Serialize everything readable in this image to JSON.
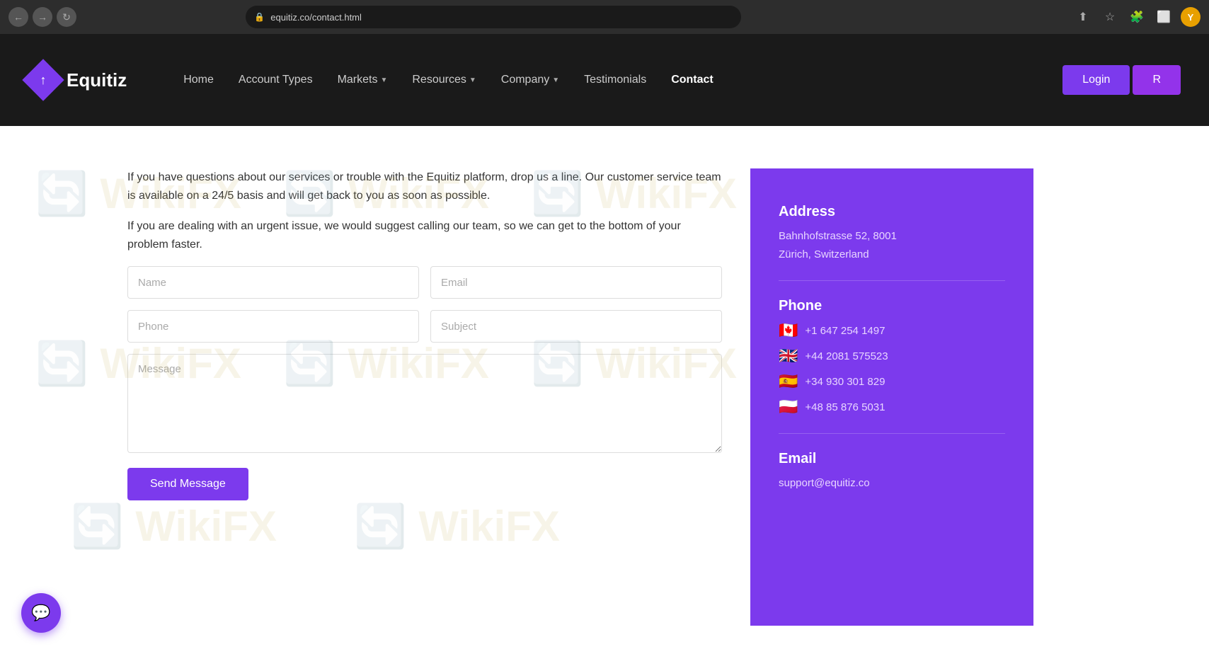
{
  "browser": {
    "url": "equitiz.co/contact.html",
    "profile_initial": "Y"
  },
  "navbar": {
    "logo_text": "Equitiz",
    "nav_items": [
      {
        "label": "Home",
        "has_dropdown": false,
        "active": false
      },
      {
        "label": "Account Types",
        "has_dropdown": false,
        "active": false
      },
      {
        "label": "Markets",
        "has_dropdown": true,
        "active": false
      },
      {
        "label": "Resources",
        "has_dropdown": true,
        "active": false
      },
      {
        "label": "Company",
        "has_dropdown": true,
        "active": false
      },
      {
        "label": "Testimonials",
        "has_dropdown": false,
        "active": false
      },
      {
        "label": "Contact",
        "has_dropdown": false,
        "active": true
      }
    ],
    "login_label": "Login",
    "register_label": "R"
  },
  "contact": {
    "intro_paragraph_1": "If you have questions about our services or trouble with the Equitiz platform, drop us a line. Our customer service team is available on a 24/5 basis and will get back to you as soon as possible.",
    "intro_paragraph_2": "If you are dealing with an urgent issue, we would suggest calling our team, so we can get to the bottom of your problem faster.",
    "form": {
      "name_placeholder": "Name",
      "email_placeholder": "Email",
      "phone_placeholder": "Phone",
      "subject_placeholder": "Subject",
      "message_placeholder": "Message",
      "send_button_label": "Send Message"
    },
    "sidebar": {
      "address_title": "Address",
      "address_value": "Bahnhofstrasse 52, 8001\nZürich, Switzerland",
      "phone_title": "Phone",
      "phones": [
        {
          "flag": "🇨🇦",
          "number": "+1 647 254 1497"
        },
        {
          "flag": "🇬🇧",
          "number": "+44 2081 575523"
        },
        {
          "flag": "🇪🇸",
          "number": "+34 930 301 829"
        },
        {
          "flag": "🇵🇱",
          "number": "+48 85 876 5031"
        }
      ],
      "email_title": "Email",
      "email_value": "support@equitiz.co"
    }
  },
  "chat_button": {
    "icon": "💬"
  }
}
